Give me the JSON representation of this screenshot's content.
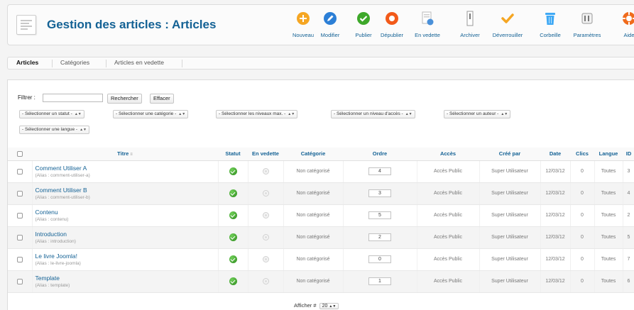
{
  "header": {
    "title": "Gestion des articles : Articles",
    "buttons": [
      {
        "id": "new",
        "label": "Nouveau",
        "icon": "plus-circle-icon",
        "color": "#f5a623"
      },
      {
        "id": "edit",
        "label": "Modifier",
        "icon": "pencil-icon",
        "color": "#2c7fd6"
      },
      {
        "id": "publish",
        "label": "Publier",
        "icon": "check-circle-icon",
        "color": "#3ea82a"
      },
      {
        "id": "unpublish",
        "label": "Dépublier",
        "icon": "circle-icon",
        "color": "#f25a1a"
      },
      {
        "id": "featured",
        "label": "En vedette",
        "icon": "featured-doc-icon",
        "color": "#4a90d9"
      },
      {
        "id": "archive",
        "label": "Archiver",
        "icon": "archive-icon",
        "color": "#888888"
      },
      {
        "id": "checkin",
        "label": "Déverrouiller",
        "icon": "checkmark-icon",
        "color": "#f5a623"
      },
      {
        "id": "trash",
        "label": "Corbeille",
        "icon": "trash-icon",
        "color": "#3fa9f5"
      },
      {
        "id": "options",
        "label": "Paramètres",
        "icon": "options-icon",
        "color": "#777777"
      },
      {
        "id": "help",
        "label": "Aide",
        "icon": "help-lifebuoy-icon",
        "color": "#f06b1c"
      }
    ]
  },
  "tabs": [
    {
      "label": "Articles",
      "active": true
    },
    {
      "label": "Catégories",
      "active": false
    },
    {
      "label": "Articles en vedette",
      "active": false
    }
  ],
  "filter": {
    "label": "Filtrer :",
    "value": "",
    "search_button": "Rechercher",
    "clear_button": "Effacer",
    "selects": [
      "- Sélectionner un statut -",
      "- Sélectionner une catégorie -",
      "- Sélectionner les niveaux max. -",
      "- Sélectionner un niveau d'accès -",
      "- Sélectionner un auteur -",
      "- Sélectionner une langue -"
    ]
  },
  "table": {
    "columns": {
      "title": "Titre",
      "status": "Statut",
      "featured": "En vedette",
      "category": "Catégorie",
      "ordering": "Ordre",
      "access": "Accès",
      "created_by": "Créé par",
      "date": "Date",
      "hits": "Clics",
      "language": "Langue",
      "id": "ID"
    },
    "rows": [
      {
        "title": "Comment Utiliser A",
        "alias": "(Alias : comment-utiliser-a)",
        "category": "Non catégorisé",
        "ordering": "4",
        "access": "Accès Public",
        "author": "Super Utilisateur",
        "date": "12/03/12",
        "hits": "0",
        "language": "Toutes",
        "id": "3"
      },
      {
        "title": "Comment Utiliser B",
        "alias": "(Alias : comment-utiliser-b)",
        "category": "Non catégorisé",
        "ordering": "3",
        "access": "Accès Public",
        "author": "Super Utilisateur",
        "date": "12/03/12",
        "hits": "0",
        "language": "Toutes",
        "id": "4"
      },
      {
        "title": "Contenu",
        "alias": "(Alias : contenu)",
        "category": "Non catégorisé",
        "ordering": "5",
        "access": "Accès Public",
        "author": "Super Utilisateur",
        "date": "12/03/12",
        "hits": "0",
        "language": "Toutes",
        "id": "2"
      },
      {
        "title": "Introduction",
        "alias": "(Alias : introduction)",
        "category": "Non catégorisé",
        "ordering": "2",
        "access": "Accès Public",
        "author": "Super Utilisateur",
        "date": "12/03/12",
        "hits": "0",
        "language": "Toutes",
        "id": "5"
      },
      {
        "title": "Le livre Joomla!",
        "alias": "(Alias : le-livre-joomla)",
        "category": "Non catégorisé",
        "ordering": "0",
        "access": "Accès Public",
        "author": "Super Utilisateur",
        "date": "12/03/12",
        "hits": "0",
        "language": "Toutes",
        "id": "7"
      },
      {
        "title": "Template",
        "alias": "(Alias : template)",
        "category": "Non catégorisé",
        "ordering": "1",
        "access": "Accès Public",
        "author": "Super Utilisateur",
        "date": "12/03/12",
        "hits": "0",
        "language": "Toutes",
        "id": "6"
      }
    ]
  },
  "pagination": {
    "label": "Afficher #",
    "value": "20"
  }
}
